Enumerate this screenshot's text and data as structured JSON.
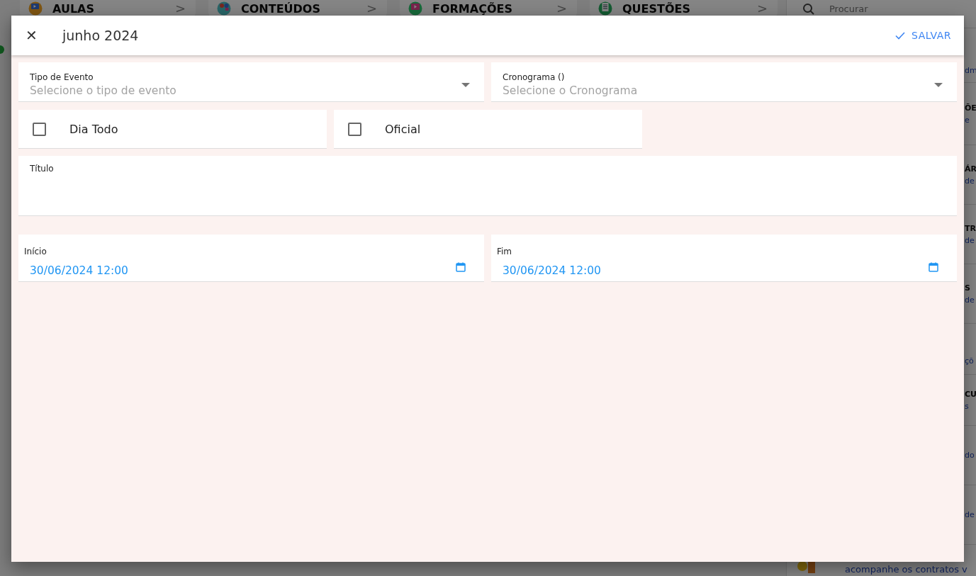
{
  "background": {
    "cards": [
      {
        "label": "AULAS",
        "chevron": ">"
      },
      {
        "label": "CONTEÚDOS",
        "chevron": ">"
      },
      {
        "label": "FORMAÇÕES",
        "chevron": ">"
      },
      {
        "label": "QUESTÕES",
        "chevron": ">"
      }
    ],
    "search": {
      "placeholder": "Procurar"
    },
    "list": [
      {
        "kind": "fragment",
        "subtitle": "dm"
      },
      {
        "kind": "fragment",
        "heading": "ÕE",
        "subtitle": "e"
      },
      {
        "kind": "fragment",
        "heading": "ÁR",
        "subtitle": "de"
      },
      {
        "kind": "fragment",
        "heading": "TR",
        "subtitle": "de"
      },
      {
        "kind": "fragment",
        "heading": "S",
        "subtitle": "de"
      },
      {
        "kind": "fragment",
        "subtitle": "çõ"
      },
      {
        "kind": "fragment",
        "heading": "CU",
        "subtitle": "s"
      },
      {
        "kind": "fragment",
        "subtitle": "do"
      },
      {
        "kind": "fragment",
        "subtitle": "de"
      },
      {
        "kind": "full",
        "subtitle": "acompanhe os contratos v"
      }
    ]
  },
  "dialog": {
    "title": "junho 2024",
    "close": "✕",
    "save": "SALVAR",
    "selects": [
      {
        "label": "Tipo de Evento",
        "placeholder": "Selecione o tipo de evento"
      },
      {
        "label": "Cronograma ()",
        "placeholder": "Selecione o Cronograma"
      }
    ],
    "checkboxes": [
      {
        "label": "Dia Todo",
        "checked": false
      },
      {
        "label": "Oficial",
        "checked": false
      }
    ],
    "title_field": {
      "label": "Título"
    },
    "dates": [
      {
        "label": "Início",
        "value": "30/06/2024 12:00"
      },
      {
        "label": "Fim",
        "value": "30/06/2024 12:00"
      }
    ]
  }
}
